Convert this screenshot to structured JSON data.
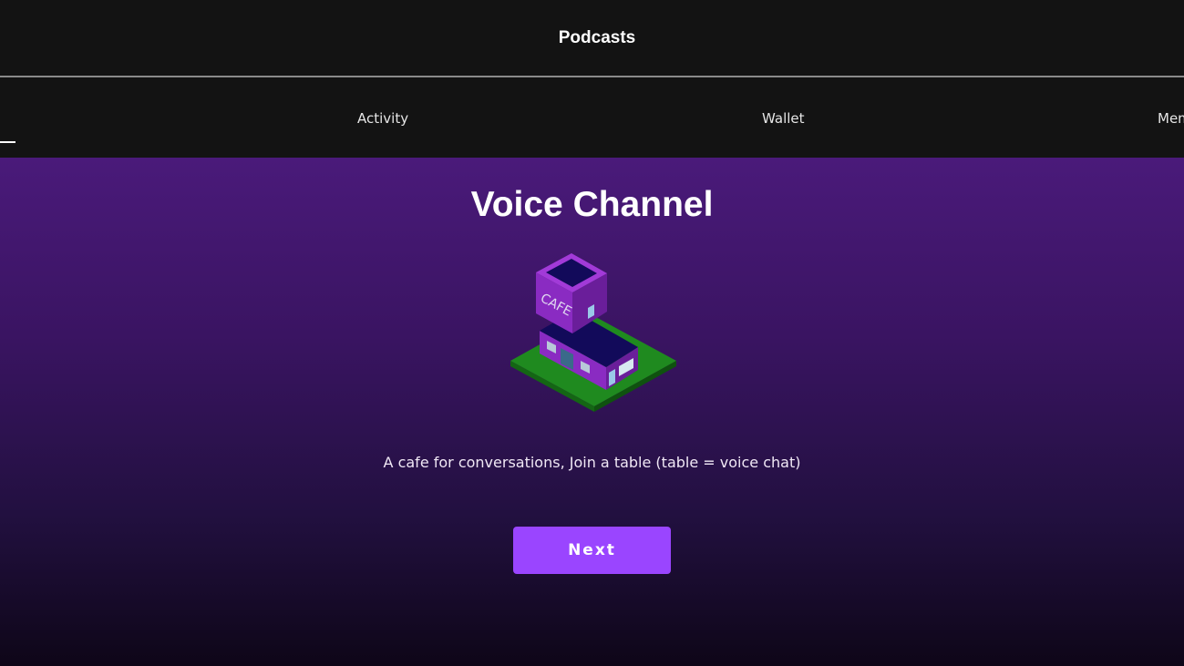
{
  "header": {
    "title": "Podcasts"
  },
  "tabs": [
    {
      "label": ""
    },
    {
      "label": "Activity"
    },
    {
      "label": "Wallet"
    },
    {
      "label": "Mem"
    }
  ],
  "hero": {
    "title": "Voice Channel",
    "illustration_sign": "CAFE",
    "description": "A cafe for conversations,  Join a table (table = voice chat)",
    "next_label": "Next"
  },
  "colors": {
    "background": "#131313",
    "accent_button": "#9a45ff",
    "gradient_top": "#4a1a7a",
    "gradient_bottom": "#0e0618",
    "grass": "#1f8a1f",
    "building": "#8a2bc2",
    "roof": "#120a5a"
  }
}
